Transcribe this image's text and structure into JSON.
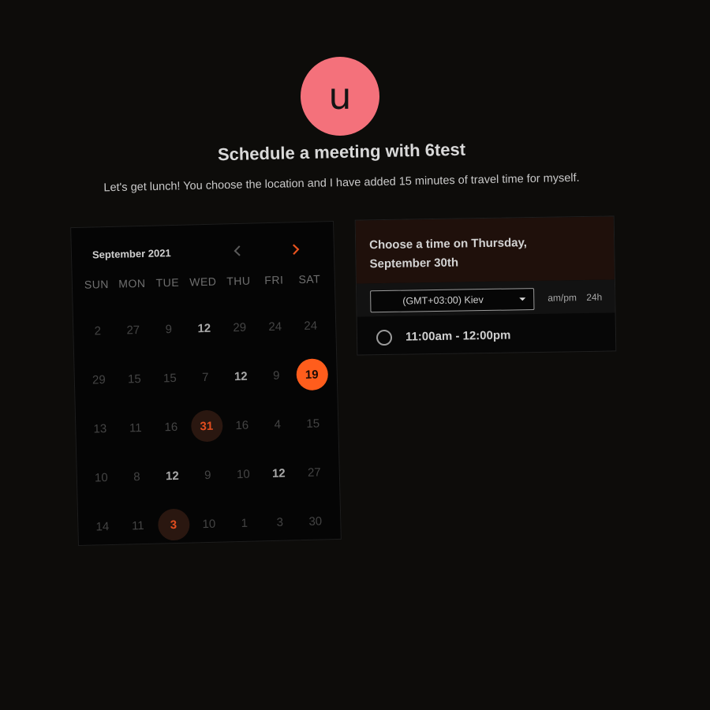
{
  "profile": {
    "initial": "u"
  },
  "header": {
    "title": "Schedule a meeting with 6test",
    "description": "Let's get lunch! You choose the location and I have added 15 minutes of travel time for myself."
  },
  "calendar": {
    "month_label": "September 2021",
    "weekdays": [
      "SUN",
      "MON",
      "TUE",
      "WED",
      "THU",
      "FRI",
      "SAT"
    ],
    "weeks": [
      [
        {
          "d": "2"
        },
        {
          "d": "27"
        },
        {
          "d": "9"
        },
        {
          "d": "12",
          "s": "avail"
        },
        {
          "d": "29"
        },
        {
          "d": "24"
        },
        {
          "d": "24"
        }
      ],
      [
        {
          "d": "29"
        },
        {
          "d": "15"
        },
        {
          "d": "15"
        },
        {
          "d": "7"
        },
        {
          "d": "12",
          "s": "avail"
        },
        {
          "d": "9"
        },
        {
          "d": "19",
          "s": "selected"
        }
      ],
      [
        {
          "d": "13"
        },
        {
          "d": "11"
        },
        {
          "d": "16"
        },
        {
          "d": "31",
          "s": "marked"
        },
        {
          "d": "16"
        },
        {
          "d": "4"
        },
        {
          "d": "15"
        }
      ],
      [
        {
          "d": "10"
        },
        {
          "d": "8"
        },
        {
          "d": "12",
          "s": "avail"
        },
        {
          "d": "9"
        },
        {
          "d": "10"
        },
        {
          "d": "12",
          "s": "avail"
        },
        {
          "d": "27"
        }
      ],
      [
        {
          "d": "14"
        },
        {
          "d": "11"
        },
        {
          "d": "3",
          "s": "marked"
        },
        {
          "d": "10"
        },
        {
          "d": "1"
        },
        {
          "d": "3"
        },
        {
          "d": "30"
        }
      ]
    ],
    "colors": {
      "accent": "#ff5d1c",
      "muted_accent_bg": "#2a1710"
    }
  },
  "time_panel": {
    "heading": "Choose a time on Thursday, September 30th",
    "timezone": "(GMT+03:00) Kiev",
    "format_ampm": "am/pm",
    "format_24h": "24h",
    "slots": [
      "11:00am - 12:00pm"
    ]
  }
}
